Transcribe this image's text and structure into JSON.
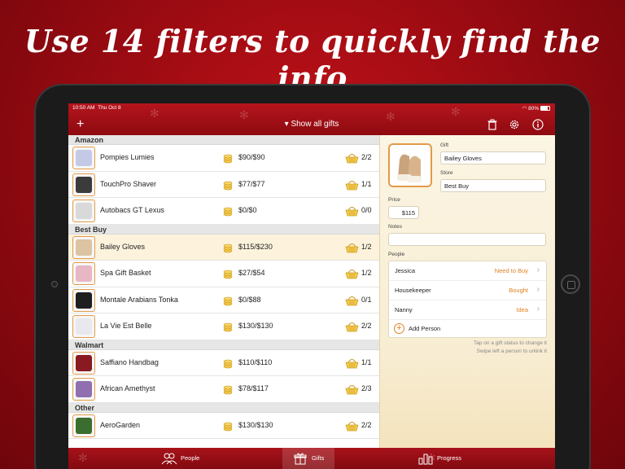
{
  "headline": "Use 14 filters to quickly find the info",
  "status_bar": {
    "time": "10:50 AM",
    "date": "Thu Oct 8",
    "battery": "80%"
  },
  "nav": {
    "add_icon": "plus-icon",
    "title": "▾ Show all gifts",
    "trash_icon": "trash-icon",
    "settings_icon": "gear-icon",
    "info_icon": "info-icon"
  },
  "sections": [
    {
      "store": "Amazon",
      "items": [
        {
          "name": "Pompies Lumies",
          "price": "$90/$90",
          "count": "2/2",
          "color": "#c4c9e8"
        },
        {
          "name": "TouchPro Shaver",
          "price": "$77/$77",
          "count": "1/1",
          "color": "#3b3b3b"
        },
        {
          "name": "Autobacs GT Lexus",
          "price": "$0/$0",
          "count": "0/0",
          "color": "#d9d9d9"
        }
      ]
    },
    {
      "store": "Best Buy",
      "items": [
        {
          "name": "Bailey Gloves",
          "price": "$115/$230",
          "count": "1/2",
          "color": "#dcc3a2",
          "selected": true
        },
        {
          "name": "Spa Gift Basket",
          "price": "$27/$54",
          "count": "1/2",
          "color": "#e7b7c3"
        },
        {
          "name": "Montale Arabians Tonka",
          "price": "$0/$88",
          "count": "0/1",
          "color": "#1f1f1f"
        },
        {
          "name": "La Vie Est Belle",
          "price": "$130/$130",
          "count": "2/2",
          "color": "#e8e8ee"
        }
      ]
    },
    {
      "store": "Walmart",
      "items": [
        {
          "name": "Saffiano Handbag",
          "price": "$110/$110",
          "count": "1/1",
          "color": "#8a1a22"
        },
        {
          "name": "African Amethyst",
          "price": "$78/$117",
          "count": "2/3",
          "color": "#8f6fb0"
        }
      ]
    },
    {
      "store": "Other",
      "items": [
        {
          "name": "AeroGarden",
          "price": "$130/$130",
          "count": "2/2",
          "color": "#3b6e2e"
        }
      ]
    }
  ],
  "detail": {
    "gift_label": "Gift",
    "gift_value": "Bailey Gloves",
    "store_label": "Store",
    "store_value": "Best Buy",
    "price_label": "Price",
    "price_value": "$115",
    "notes_label": "Notes",
    "notes_value": "",
    "people_label": "People",
    "people": [
      {
        "name": "Jessica",
        "status": "Need to Buy"
      },
      {
        "name": "Housekeeper",
        "status": "Bought"
      },
      {
        "name": "Nanny",
        "status": "Idea"
      }
    ],
    "add_person": "Add Person",
    "hint1": "Tap on a gift status to change it",
    "hint2": "Swipe left a person to unlink it"
  },
  "tabs": [
    {
      "label": "People",
      "icon": "people-icon"
    },
    {
      "label": "Gifts",
      "icon": "gift-icon",
      "active": true
    },
    {
      "label": "Progress",
      "icon": "bar-chart-icon"
    }
  ],
  "colors": {
    "accent": "#e3801f",
    "nav_red": "#a8121a",
    "section_bg": "#e6e6e6"
  }
}
